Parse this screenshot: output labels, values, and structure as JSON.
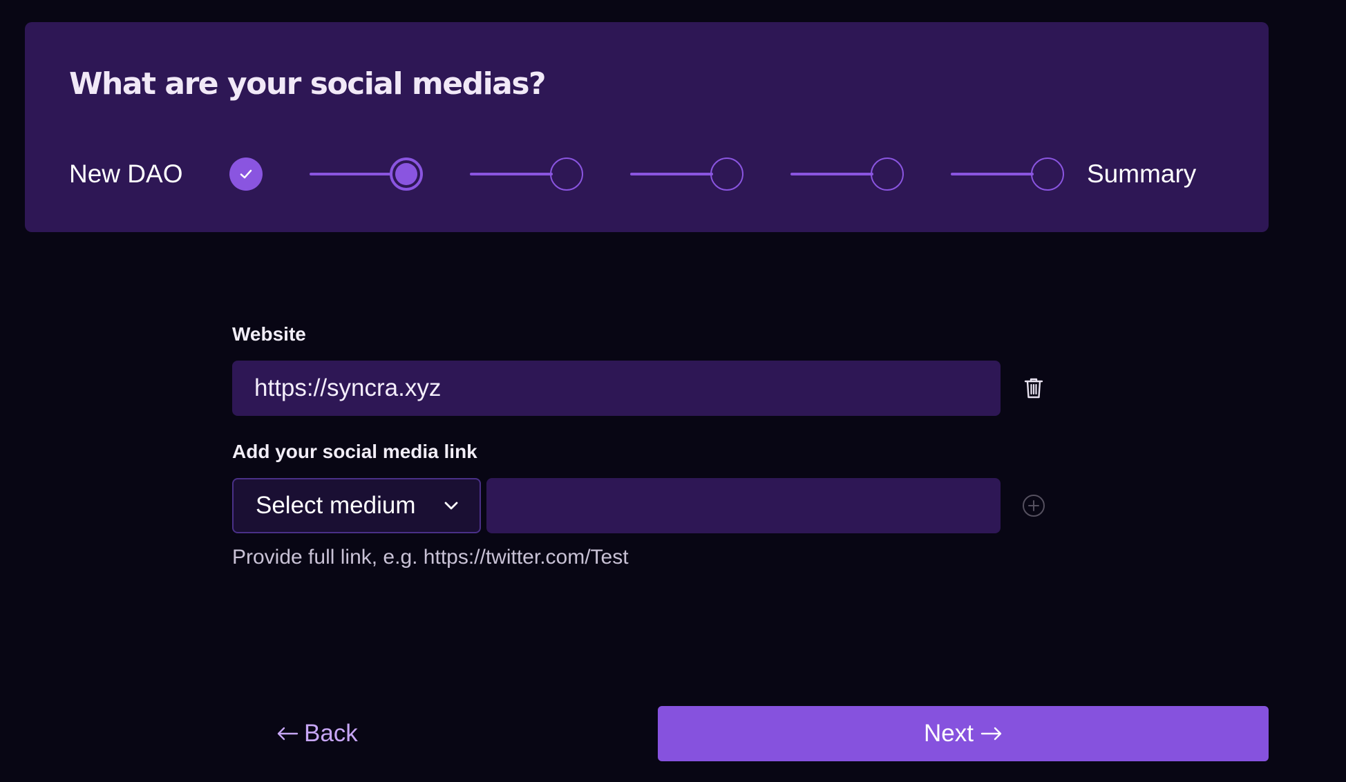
{
  "header": {
    "title": "What are your social medias?"
  },
  "stepper": {
    "start_label": "New DAO",
    "end_label": "Summary",
    "steps": [
      {
        "state": "done",
        "icon": "check-icon"
      },
      {
        "state": "current"
      },
      {
        "state": "upcoming"
      },
      {
        "state": "upcoming"
      },
      {
        "state": "upcoming"
      },
      {
        "state": "upcoming"
      }
    ]
  },
  "form": {
    "website_label": "Website",
    "website_value": "https://syncra.xyz",
    "delete_icon": "trash-icon",
    "social_label": "Add your social media link",
    "select_value": "Select medium",
    "select_icon": "chevron-down-icon",
    "social_link_value": "",
    "add_icon": "plus-circle-icon",
    "helper_text": "Provide full link, e.g. https://twitter.com/Test"
  },
  "footer": {
    "back_label": "Back",
    "next_label": "Next"
  },
  "colors": {
    "background": "#080614",
    "card": "#2e1755",
    "accent": "#8a55e0",
    "select_bg": "#1a0f33",
    "back_text": "#c7a6f5"
  }
}
